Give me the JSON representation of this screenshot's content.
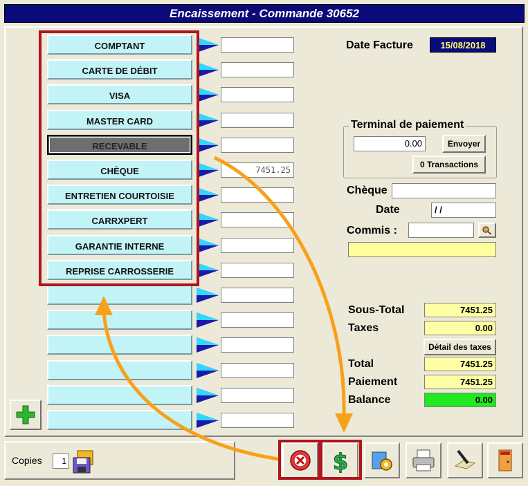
{
  "window": {
    "title": "Encaissement - Commande 30652"
  },
  "payment_methods": [
    {
      "label": "COMPTANT",
      "amount": ""
    },
    {
      "label": "CARTE DE DÉBIT",
      "amount": ""
    },
    {
      "label": "VISA",
      "amount": ""
    },
    {
      "label": "MASTER CARD",
      "amount": ""
    },
    {
      "label": "RECEVABLE",
      "amount": ""
    },
    {
      "label": "CHÈQUE",
      "amount": "7451.25"
    },
    {
      "label": "ENTRETIEN COURTOISIE",
      "amount": ""
    },
    {
      "label": "CARRXPERT",
      "amount": ""
    },
    {
      "label": "GARANTIE INTERNE",
      "amount": ""
    },
    {
      "label": "REPRISE CARROSSERIE",
      "amount": ""
    },
    {
      "label": "",
      "amount": ""
    },
    {
      "label": "",
      "amount": ""
    },
    {
      "label": "",
      "amount": ""
    },
    {
      "label": "",
      "amount": ""
    },
    {
      "label": "",
      "amount": ""
    },
    {
      "label": "",
      "amount": ""
    }
  ],
  "invoice": {
    "date_label": "Date Facture",
    "date_value": "15/08/2018"
  },
  "terminal": {
    "title": "Terminal de paiement",
    "amount": "0.00",
    "send_label": "Envoyer",
    "transactions_label": "0 Transactions"
  },
  "cheque": {
    "label": "Chèque",
    "value": "",
    "date_label": "Date",
    "date_value": " / /",
    "commis_label": "Commis :",
    "commis_value": "",
    "note": ""
  },
  "totals": {
    "subtotal_label": "Sous-Total",
    "subtotal": "7451.25",
    "taxes_label": "Taxes",
    "taxes": "0.00",
    "tax_detail_label": "Détail des taxes",
    "total_label": "Total",
    "total": "7451.25",
    "payment_label": "Paiement",
    "payment": "7451.25",
    "balance_label": "Balance",
    "balance": "0.00"
  },
  "footer": {
    "copies_label": "Copies",
    "copies_value": "1"
  },
  "colors": {
    "title_bar": "#0a0a7a",
    "method_button": "#c2f3f7",
    "selected_button": "#6e6e6e",
    "highlight": "#b0141c",
    "total_field": "#ffffa6",
    "balance_field": "#22e822",
    "annotation_arrow": "#f7a11a"
  },
  "icons": {
    "add": "plus-icon",
    "save": "floppy-disk-icon",
    "cancel": "cancel-icon",
    "pay": "dollar-icon",
    "settings": "settings-icon",
    "print": "printer-icon",
    "sign": "signature-icon",
    "exit": "exit-door-icon",
    "search": "search-icon",
    "arrow": "triangle-arrow-icon"
  }
}
